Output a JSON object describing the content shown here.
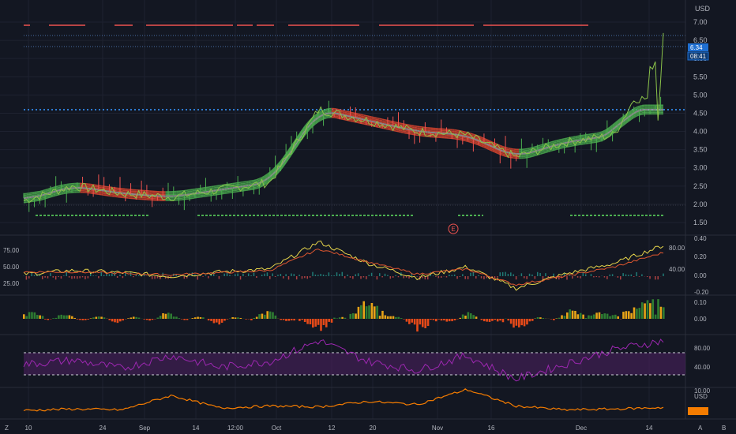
{
  "colors": {
    "background": "#131722",
    "grid": "#1e2230",
    "up": "#26a69a",
    "down": "#ef5350",
    "ribbon_green": "#4caf50",
    "ribbon_red": "#e0472f",
    "ribbon_gray": "#9e9e9e",
    "macd_line": "#e8d64b",
    "signal_line": "#e1572f",
    "rsi": "#9c27b0",
    "volume_line": "#f57c00",
    "price_tag": "#2962ff"
  },
  "price_panel": {
    "currency": "USD",
    "y_ticks": [
      "7.00",
      "6.50",
      "6.00",
      "5.50",
      "5.00",
      "4.50",
      "4.00",
      "3.50",
      "3.00",
      "2.50",
      "2.00",
      "1.50"
    ],
    "last_price": "6.34",
    "countdown": "08:41",
    "earnings_marker": "E"
  },
  "oscillator_panel": {
    "left_ticks": [
      "75.00",
      "50.00",
      "25.00"
    ],
    "right_ticks": [
      "0.40",
      "0.20",
      "0.00",
      "-0.20"
    ],
    "mid_ticks": [
      "80.00",
      "40.00"
    ]
  },
  "histogram_panel": {
    "right_ticks": [
      "0.10",
      "0.00"
    ]
  },
  "rsi_panel": {
    "right_ticks": [
      "80.00",
      "40.00"
    ]
  },
  "volume_panel": {
    "currency": "USD",
    "top_tick": "10.00"
  },
  "time_axis": {
    "labels": [
      "10",
      "24",
      "Sep",
      "14",
      "12:00",
      "Oct",
      "12",
      "20",
      "Nov",
      "16",
      "Dec",
      "14"
    ]
  },
  "footer": {
    "left_label": "Z",
    "right_labels": [
      "A",
      "B"
    ]
  },
  "chart_data": [
    {
      "type": "line",
      "title": "",
      "x": [
        "10",
        "24",
        "Sep",
        "14",
        "12:00",
        "Oct",
        "12",
        "20",
        "Nov",
        "16",
        "Dec",
        "14"
      ],
      "series": [
        {
          "values": [
            2.1,
            2.5,
            2.3,
            2.2,
            2.4,
            2.6,
            4.6,
            4.3,
            4.0,
            3.9,
            3.3,
            3.7,
            3.9,
            6.34
          ]
        }
      ],
      "ylim": [
        1.3,
        7.2
      ],
      "grid": true,
      "last_value": 6.34
    },
    {
      "type": "line",
      "series": [
        {
          "values": [
            45,
            50,
            47,
            42,
            48,
            52,
            90,
            60,
            40,
            55,
            25,
            45,
            60,
            85
          ]
        },
        {
          "values": [
            48,
            48,
            46,
            44,
            47,
            50,
            80,
            62,
            45,
            52,
            30,
            42,
            55,
            75
          ]
        }
      ],
      "ylim": [
        20,
        95
      ]
    },
    {
      "type": "bar",
      "series": [
        {
          "values": [
            0.02,
            0.01,
            -0.01,
            0.02,
            -0.02,
            0.03,
            -0.06,
            0.08,
            -0.05,
            0.02,
            -0.04,
            0.03,
            0.02,
            0.12
          ]
        }
      ],
      "ylim": [
        -0.08,
        0.13
      ]
    },
    {
      "type": "line",
      "series": [
        {
          "values": [
            55,
            62,
            48,
            70,
            50,
            60,
            95,
            60,
            45,
            70,
            30,
            55,
            80,
            95
          ]
        }
      ],
      "ylim": [
        20,
        100
      ]
    },
    {
      "type": "area",
      "series": [
        {
          "values": [
            1,
            1.5,
            1.2,
            6,
            1.8,
            2.5,
            2.2,
            4,
            3,
            8,
            2.5,
            1.2,
            1.5,
            2
          ]
        }
      ],
      "ylim": [
        0,
        10
      ]
    }
  ]
}
